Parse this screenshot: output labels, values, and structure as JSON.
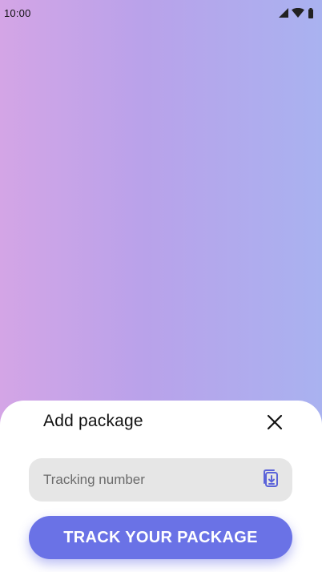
{
  "status_bar": {
    "time": "10:00",
    "icons": [
      "signal-icon",
      "wifi-icon",
      "battery-icon"
    ]
  },
  "sheet": {
    "title": "Add package",
    "tracking_field": {
      "placeholder": "Tracking number",
      "value": ""
    },
    "primary_button_label": "TRACK YOUR PACKAGE",
    "icons": [
      "close-icon",
      "paste-icon"
    ]
  },
  "colors": {
    "gradient_left": "#d4a5e6",
    "gradient_mid": "#b9a2ea",
    "gradient_right": "#a9b2f0",
    "accent": "#6a72e6",
    "field_background": "#e6e6e6"
  }
}
